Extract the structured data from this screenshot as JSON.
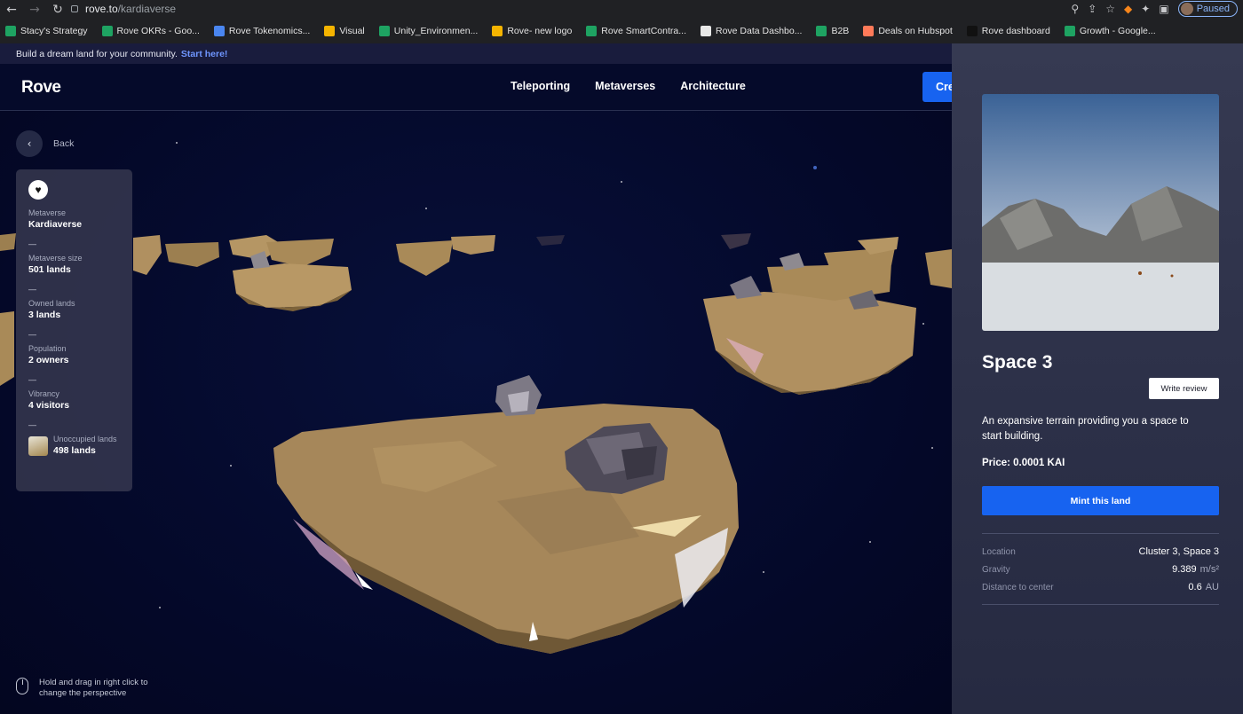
{
  "browser": {
    "url_host": "rove.to",
    "url_path": "/kardiaverse",
    "paused_label": "Paused",
    "bookmarks": [
      {
        "label": "Stacy's Strategy",
        "color": "#1ea362"
      },
      {
        "label": "Rove OKRs - Goo...",
        "color": "#1ea362"
      },
      {
        "label": "Rove Tokenomics...",
        "color": "#4a86f0"
      },
      {
        "label": "Visual",
        "color": "#f5b400"
      },
      {
        "label": "Unity_Environmen...",
        "color": "#1ea362"
      },
      {
        "label": "Rove- new logo",
        "color": "#f5b400"
      },
      {
        "label": "Rove SmartContra...",
        "color": "#1ea362"
      },
      {
        "label": "Rove Data Dashbo...",
        "color": "#e8e8e8"
      },
      {
        "label": "B2B",
        "color": "#1ea362"
      },
      {
        "label": "Deals on Hubspot",
        "color": "#ff7a59"
      },
      {
        "label": "Rove dashboard",
        "color": "#111111"
      },
      {
        "label": "Growth - Google...",
        "color": "#1ea362"
      }
    ]
  },
  "announcement": {
    "text": "Build a dream land for your community.",
    "link": "Start here!"
  },
  "header": {
    "logo": "Rove",
    "nav": [
      "Teleporting",
      "Metaverses",
      "Architecture"
    ],
    "cta": "Create"
  },
  "sidebar": {
    "back_label": "Back",
    "stats": [
      {
        "label": "Metaverse",
        "value": "Kardiaverse"
      },
      {
        "label": "Metaverse size",
        "value": "501 lands"
      },
      {
        "label": "Owned lands",
        "value": "3 lands"
      },
      {
        "label": "Population",
        "value": "2 owners"
      },
      {
        "label": "Vibrancy",
        "value": "4 visitors"
      }
    ],
    "unoccupied": {
      "label": "Unoccupied lands",
      "value": "498 lands"
    },
    "divider": "—"
  },
  "hint": "Hold and drag in right click to change the perspective",
  "panel": {
    "title": "Space 3",
    "write_review": "Write review",
    "description": "An expansive terrain providing you a space to start building.",
    "price": "Price: 0.0001 KAI",
    "mint": "Mint this land",
    "details": [
      {
        "label": "Location",
        "value": "Cluster 3, Space 3",
        "unit": ""
      },
      {
        "label": "Gravity",
        "value": "9.389",
        "unit": "m/s²"
      },
      {
        "label": "Distance to center",
        "value": "0.6",
        "unit": "AU"
      }
    ]
  },
  "colors": {
    "accent": "#1763f0",
    "link": "#6f96ff",
    "space": "#050a2a",
    "land": "#a3874f"
  }
}
